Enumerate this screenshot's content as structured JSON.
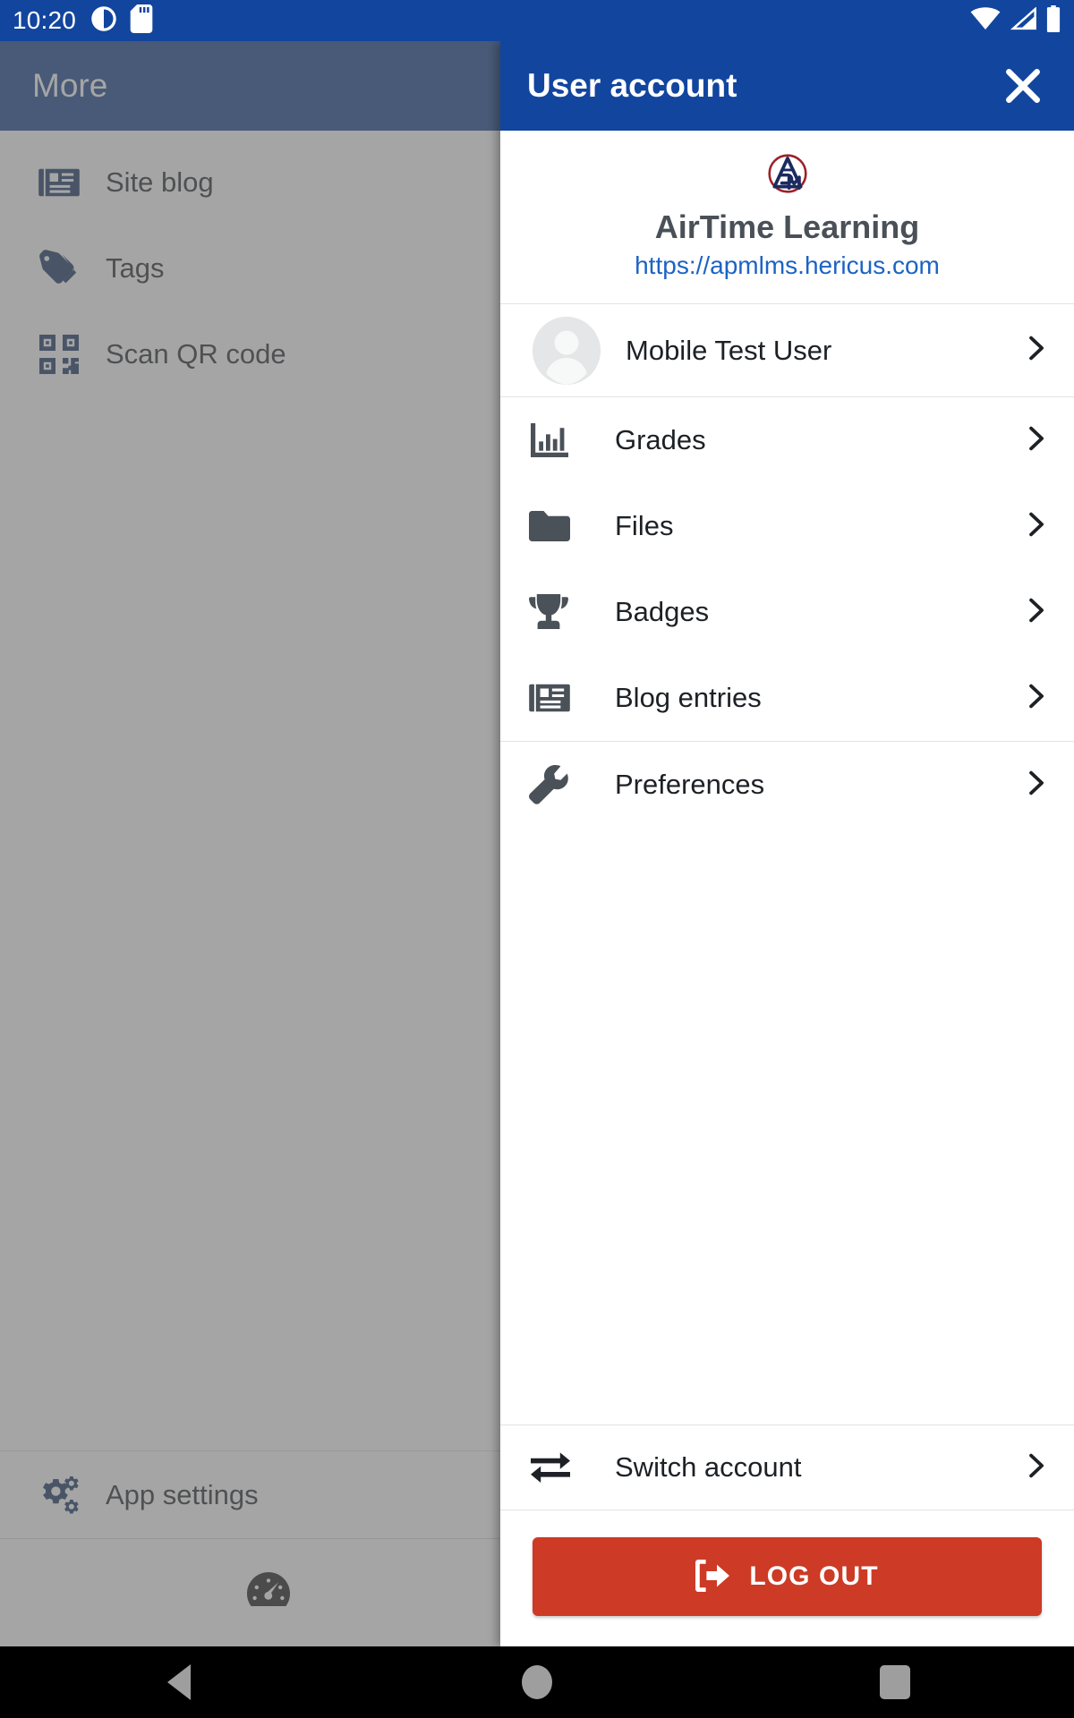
{
  "statusbar": {
    "time": "10:20",
    "icons": [
      "do-not-disturb-icon",
      "sd-card-icon",
      "wifi-icon",
      "cellular-signal-icon",
      "battery-icon"
    ]
  },
  "background_app": {
    "toolbar_title": "More",
    "menu": [
      {
        "label": "Site blog",
        "icon": "newspaper-icon"
      },
      {
        "label": "Tags",
        "icon": "tag-icon"
      },
      {
        "label": "Scan QR code",
        "icon": "qr-code-icon"
      }
    ],
    "app_settings": {
      "label": "App settings",
      "icon": "gears-icon"
    },
    "bottom_tabs": [
      {
        "icon": "dashboard-speedometer-icon"
      },
      {
        "icon": "messages-bubbles-icon"
      }
    ]
  },
  "panel": {
    "title": "User account",
    "close_icon": "close-icon",
    "site": {
      "logo_icon": "apm-logo-icon",
      "name": "AirTime Learning",
      "url": "https://apmlms.hericus.com"
    },
    "user": {
      "name": "Mobile Test User",
      "avatar_icon": "default-avatar-icon",
      "chevron": "chevron-right-icon"
    },
    "items": [
      {
        "label": "Grades",
        "icon": "bar-chart-icon"
      },
      {
        "label": "Files",
        "icon": "folder-icon"
      },
      {
        "label": "Badges",
        "icon": "trophy-icon"
      },
      {
        "label": "Blog entries",
        "icon": "newspaper-icon"
      },
      {
        "label": "Preferences",
        "icon": "wrench-icon"
      }
    ],
    "switch_account": {
      "label": "Switch account",
      "icon": "swap-arrows-icon"
    },
    "logout": {
      "label": "LOG OUT",
      "icon": "logout-door-icon"
    }
  },
  "navbar": {
    "back": "back-triangle-icon",
    "home": "home-circle-icon",
    "recents": "recents-square-icon"
  },
  "colors": {
    "status_bar": "#12459e",
    "panel_header": "#12459e",
    "app_toolbar": "#0d3b86",
    "link": "#1c63c4",
    "logout": "#cd3a26",
    "icon_navy": "#0e2d5e",
    "icon_gray": "#4a5158"
  }
}
